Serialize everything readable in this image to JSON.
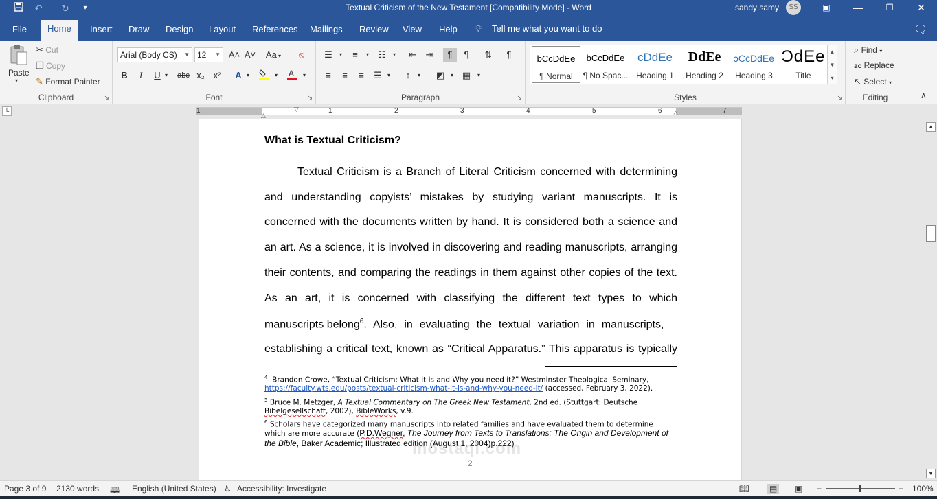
{
  "titlebar": {
    "doc_title": "Textual Criticism of the New Testament [Compatibility Mode]  -  Word",
    "user_name": "sandy samy",
    "user_initials": "SS",
    "save_icon": "save-icon",
    "undo_icon": "undo-icon",
    "redo_icon": "redo-icon",
    "customize_icon": "customize-quick-access-icon"
  },
  "tabs": [
    {
      "label": "File"
    },
    {
      "label": "Home"
    },
    {
      "label": "Insert"
    },
    {
      "label": "Draw"
    },
    {
      "label": "Design"
    },
    {
      "label": "Layout"
    },
    {
      "label": "References"
    },
    {
      "label": "Mailings"
    },
    {
      "label": "Review"
    },
    {
      "label": "View"
    },
    {
      "label": "Help"
    }
  ],
  "tell_me": "Tell me what you want to do",
  "clipboard": {
    "paste": "Paste",
    "cut": "Cut",
    "copy": "Copy",
    "format_painter": "Format Painter",
    "label": "Clipboard"
  },
  "font": {
    "name": "Arial (Body CS)",
    "size": "12",
    "label": "Font",
    "bold": "B",
    "italic": "I",
    "underline": "U",
    "strike": "abc",
    "subscript": "x₂",
    "superscript": "x²",
    "grow": "A˄",
    "shrink": "A˅",
    "case": "Aa",
    "font_color_hex": "#e81123",
    "highlight_hex": "#ffff00"
  },
  "paragraph": {
    "label": "Paragraph"
  },
  "styles": {
    "label": "Styles",
    "items": [
      {
        "sample": "bCcDdEe",
        "name": "¶ Normal"
      },
      {
        "sample": "bCcDdEe",
        "name": "¶ No Spac..."
      },
      {
        "sample": "cDdEe",
        "name": "Heading 1"
      },
      {
        "sample": "DdEe",
        "name": "Heading 2"
      },
      {
        "sample": "ɔCcDdEe",
        "name": "Heading 3"
      },
      {
        "sample": "ƆdEe",
        "name": "Title"
      }
    ]
  },
  "editing": {
    "label": "Editing",
    "find": "Find",
    "replace": "Replace",
    "select": "Select"
  },
  "ruler": {
    "numbers": [
      "1",
      "1",
      "2",
      "3",
      "4",
      "5",
      "6",
      "7"
    ]
  },
  "document": {
    "heading": "What is Textual Criticism?",
    "body_lines": [
      "Textual Criticism is a Branch of Literal Criticism concerned with determining",
      "and understanding copyists’ mistakes by studying variant manuscripts. It is",
      "concerned with the documents written by hand. It is considered both a science and",
      "an art. As a science, it is involved in discovering and reading manuscripts, arranging",
      "their contents, and comparing the readings in them against other copies of the text.",
      "As an art, it is concerned with classifying the different text types to which",
      "manuscripts belong",
      "establishing a critical text, known as “Critical Apparatus.” This apparatus is typically"
    ],
    "line7_sup": "6",
    "line7_tail": ". Also, in evaluating the textual variation in manuscripts,",
    "footnotes": {
      "fn4_num": "4",
      "fn4_text": "Brandon Crowe, “Textual Criticism: What it is and Why you need it?” Westminster Theological Seminary,",
      "fn4_link": "https://faculty.wts.edu/posts/textual-criticism-what-it-is-and-why-you-need-it/",
      "fn4_tail": " (accessed, February 3, 2022).",
      "fn5_num": "5",
      "fn5_pre": "Bruce M. Metzger, ",
      "fn5_italic": "A Textual Commentary on The Greek New Testament",
      "fn5_post": ", 2nd ed. (Stuttgart: Deutsche",
      "fn5_l2_a": "Bibelgesellschaft",
      "fn5_l2_b": ", 2002), ",
      "fn5_l2_c": "BibleWorks",
      "fn5_l2_d": ", v.9.",
      "fn6_num": "6",
      "fn6_text": "Scholars have categorized many manuscripts into related families and have evaluated them to determine",
      "fn6_l2_a": "which are more accurate (",
      "fn6_l2_b": "P.D.Wegner",
      "fn6_l2_c": ", ",
      "fn6_l2_d": "The Journey from Texts to Translations: The Origin and Development of",
      "fn6_l3_a": "the Bible",
      "fn6_l3_b": ", Baker Academic; Illustrated edition (August 1, 2004)p.222)"
    },
    "page_number": "2"
  },
  "watermark": "mostaql.com",
  "statusbar": {
    "page": "Page 3 of 9",
    "words": "2130 words",
    "language": "English (United States)",
    "accessibility": "Accessibility: Investigate",
    "zoom": "100%",
    "zoom_minus": "−",
    "zoom_plus": "+"
  },
  "colors": {
    "accent": "#2b579a",
    "ribbon_bg": "#f3f3f3",
    "canvas_bg": "#e6e6e6",
    "link": "#1a56c8"
  }
}
